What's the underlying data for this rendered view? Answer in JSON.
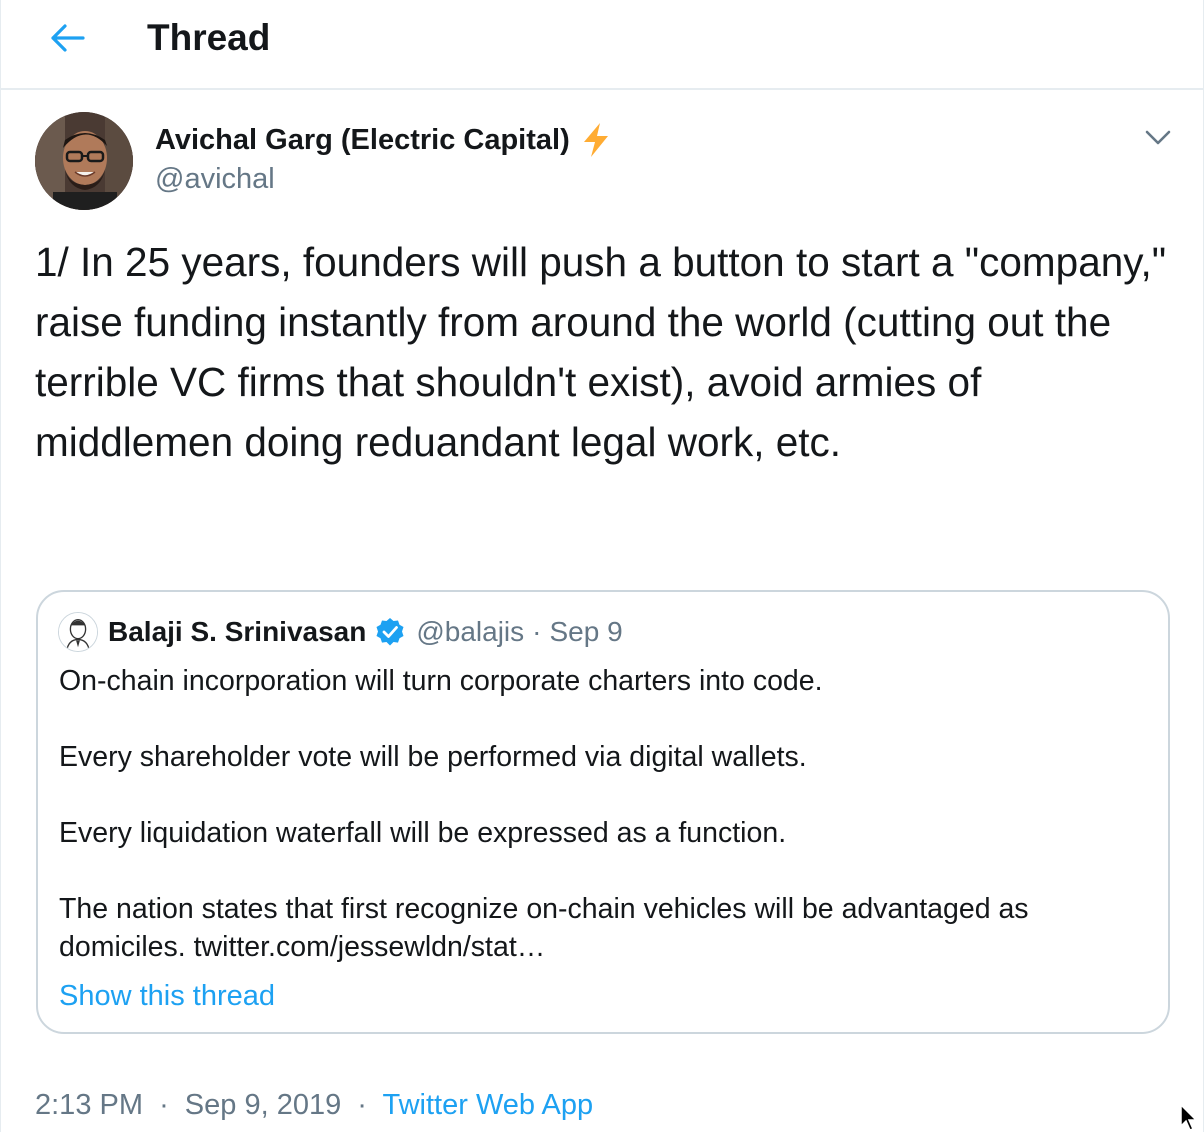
{
  "header": {
    "title": "Thread",
    "back_icon": "arrow-left-icon"
  },
  "colors": {
    "accent": "#1da1f2",
    "text": "#14171a",
    "muted": "#657786",
    "border": "#ccd6dd",
    "bolt": "#ffac33"
  },
  "tweet": {
    "author_name": "Avichal Garg (Electric Capital)",
    "author_emoji": "lightning-bolt-icon",
    "author_handle": "@avichal",
    "text": "1/ In 25 years, founders will push a button to start a \"company,\" raise funding instantly from around the world (cutting out the terrible VC firms that shouldn't exist), avoid armies of middlemen doing reduandant legal work, etc.",
    "time": "2:13 PM",
    "date": "Sep 9, 2019",
    "source": "Twitter Web App",
    "separator": "·"
  },
  "quote": {
    "name": "Balaji S. Srinivasan",
    "verified": true,
    "handle": "@balajis",
    "separator": "·",
    "date": "Sep 9",
    "text": "On-chain incorporation will turn corporate charters into code.\n\nEvery shareholder vote will be performed via digital wallets.\n\nEvery liquidation waterfall will be expressed as a function.\n\nThe nation states that first recognize on-chain vehicles will be advantaged as domiciles. twitter.com/jessewldn/stat…",
    "show_thread": "Show this thread"
  }
}
